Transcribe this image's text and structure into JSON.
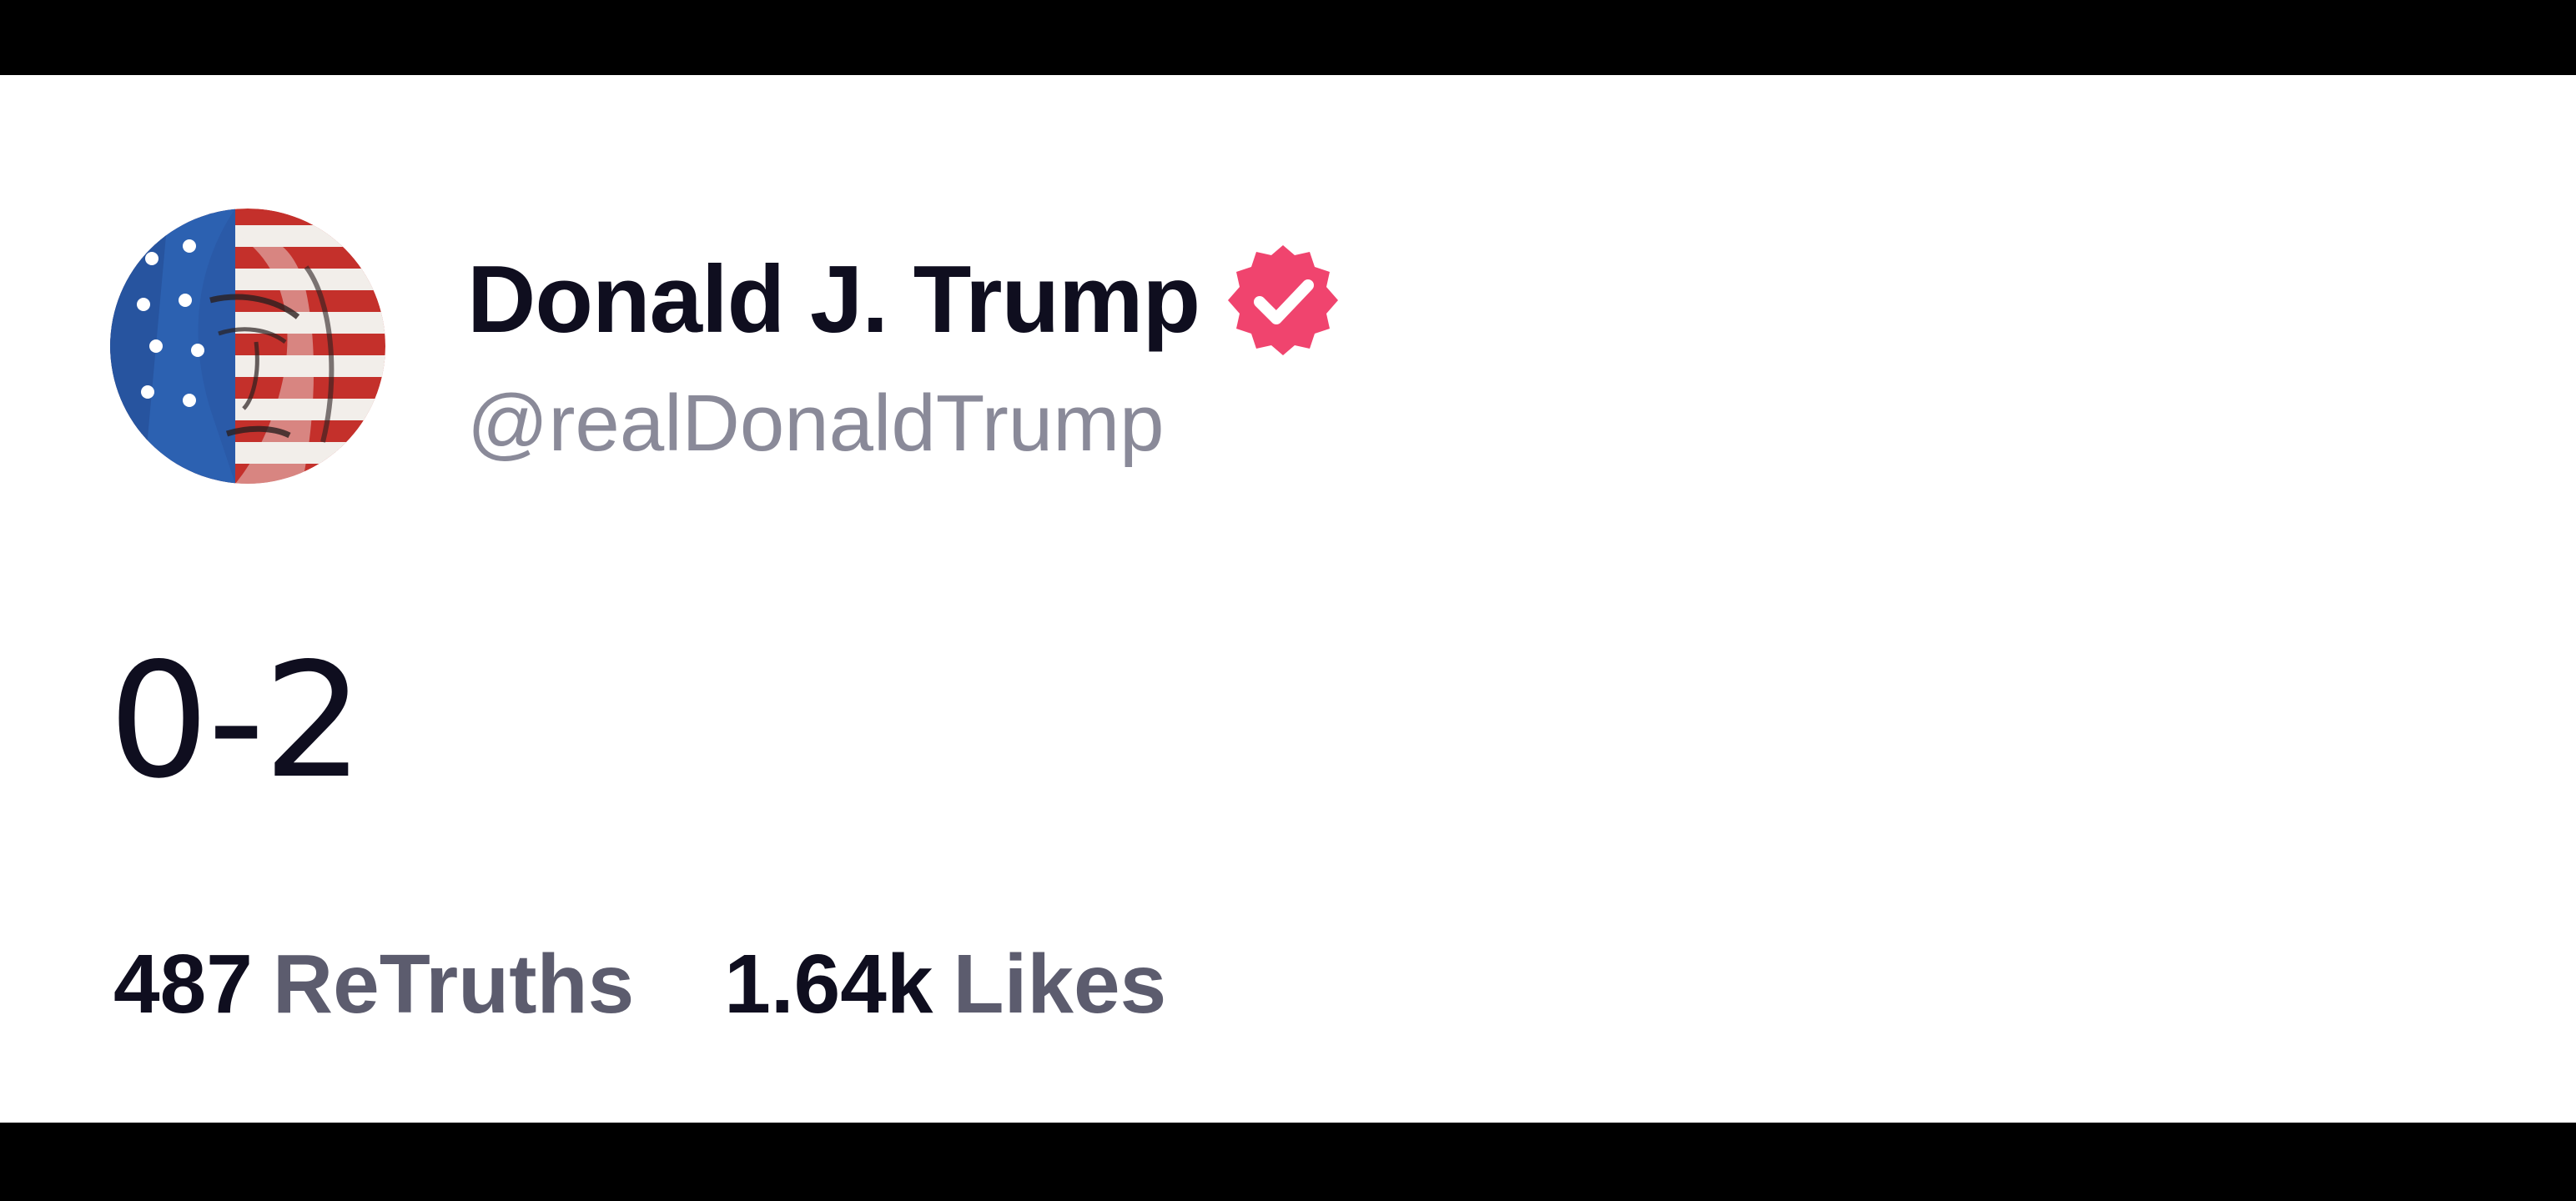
{
  "post": {
    "author": {
      "display_name": "Donald J. Trump",
      "handle": "@realDonaldTrump",
      "verified": true,
      "avatar_icon": "flag-portrait-avatar",
      "badge_icon": "verified-badge-icon"
    },
    "text": "0-2",
    "stats": {
      "retruths_count": "487",
      "retruths_label": "ReTruths",
      "likes_count": "1.64k",
      "likes_label": "Likes"
    }
  },
  "colors": {
    "background": "#ffffff",
    "frame": "#000000",
    "text_primary": "#0f0e1f",
    "text_handle": "#8a8a99",
    "text_label": "#5c5c6e",
    "verified_badge": "#f0446e"
  }
}
